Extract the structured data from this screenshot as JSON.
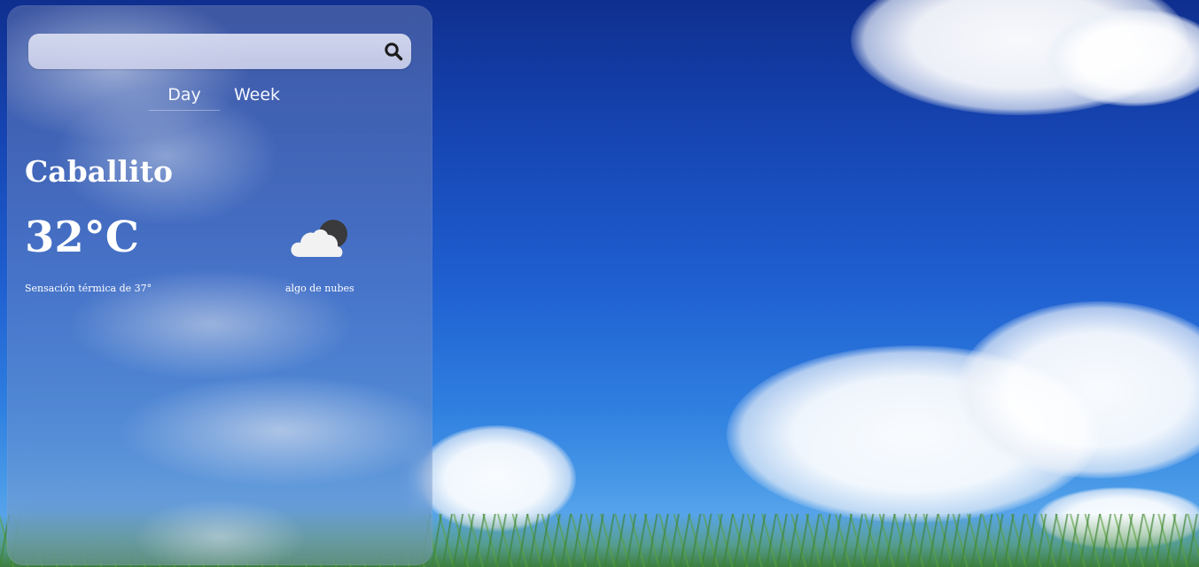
{
  "search": {
    "placeholder": "",
    "value": "",
    "icon": "search-icon"
  },
  "tabs": [
    {
      "label": "Day",
      "active": true
    },
    {
      "label": "Week",
      "active": false
    }
  ],
  "weather": {
    "city": "Caballito",
    "temperature": "32°C",
    "feels_like": "Sensación térmica de 37°",
    "description": "algo de nubes",
    "icon": "cloud-night-icon"
  },
  "colors": {
    "panel_text": "#ffffff",
    "sky": "#1f5fd0"
  }
}
